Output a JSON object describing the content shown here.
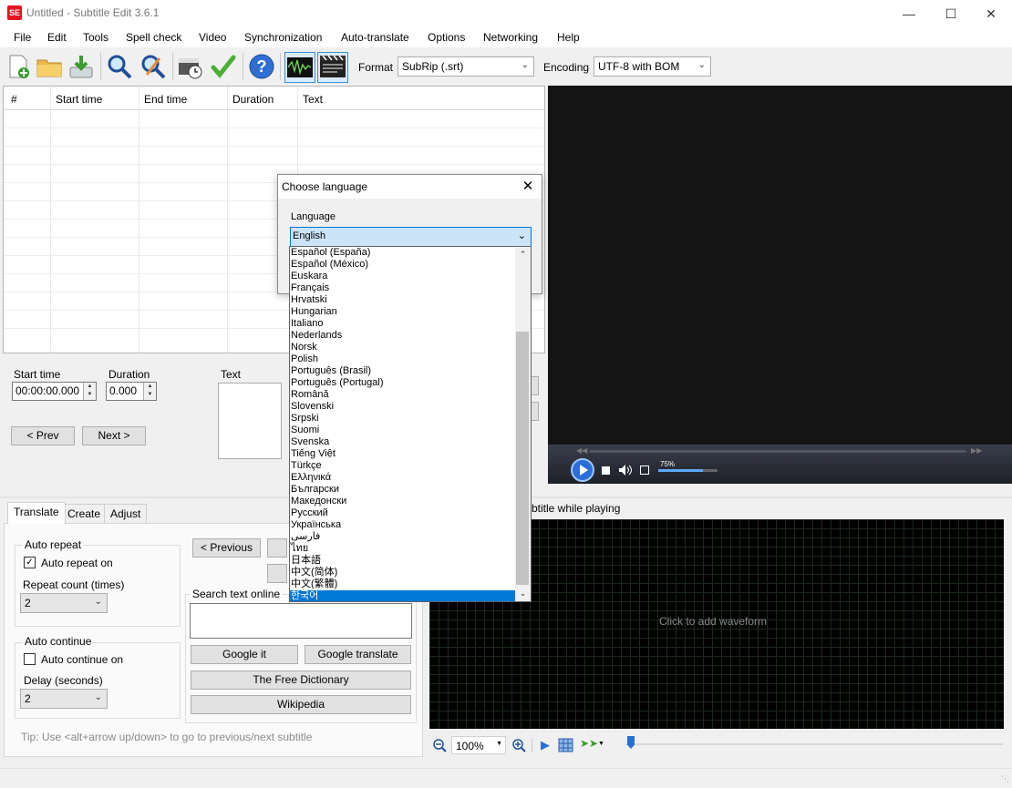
{
  "window": {
    "title": "Untitled - Subtitle Edit 3.6.1",
    "app_icon_text": "SE",
    "minimize": "—",
    "maximize": "☐",
    "close": "✕"
  },
  "menu": [
    "File",
    "Edit",
    "Tools",
    "Spell check",
    "Video",
    "Synchronization",
    "Auto-translate",
    "Options",
    "Networking",
    "Help"
  ],
  "toolbar": {
    "format_label": "Format",
    "format_value": "SubRip (.srt)",
    "encoding_label": "Encoding",
    "encoding_value": "UTF-8 with BOM",
    "icons": [
      "new-file-icon",
      "open-folder-icon",
      "download-icon",
      "find-icon",
      "replace-icon",
      "visual-sync-icon",
      "spell-check-icon",
      "help-icon",
      "waveform-toggle-icon",
      "video-toggle-icon"
    ]
  },
  "grid": {
    "columns": [
      "#",
      "Start time",
      "End time",
      "Duration",
      "Text"
    ]
  },
  "edit": {
    "start_time_label": "Start time",
    "start_time_value": "00:00:00.000",
    "duration_label": "Duration",
    "duration_value": "0.000",
    "text_label": "Text",
    "prev_label": "< Prev",
    "next_label": "Next >"
  },
  "video": {
    "volume_label": "75%"
  },
  "tabs": [
    "Translate",
    "Create",
    "Adjust"
  ],
  "translate": {
    "auto_repeat_title": "Auto repeat",
    "auto_repeat_on_label": "Auto repeat on",
    "auto_repeat_checked": true,
    "repeat_count_label": "Repeat count (times)",
    "repeat_count_value": "2",
    "auto_continue_title": "Auto continue",
    "auto_continue_on_label": "Auto continue on",
    "auto_continue_checked": false,
    "delay_label": "Delay (seconds)",
    "delay_value": "2",
    "previous_label": "< Previous",
    "search_online_label": "Search text online",
    "google_it": "Google it",
    "google_translate": "Google translate",
    "free_dictionary": "The Free Dictionary",
    "wikipedia": "Wikipedia",
    "tip": "Tip: Use <alt+arrow up/down> to go to previous/next subtitle"
  },
  "waveform": {
    "partial_label": "btitle while playing",
    "hint": "Click to add waveform",
    "zoom_value": "100%"
  },
  "dialog": {
    "title": "Choose language",
    "language_label": "Language",
    "selected": "English",
    "options": [
      "Español (España)",
      "Español (México)",
      "Euskara",
      "Français",
      "Hrvatski",
      "Hungarian",
      "Italiano",
      "Nederlands",
      "Norsk",
      "Polish",
      "Português (Brasil)",
      "Português (Portugal)",
      "Română",
      "Slovenski",
      "Srpski",
      "Suomi",
      "Svenska",
      "Tiếng Việt",
      "Türkçe",
      "Ελληνικά",
      "Български",
      "Македонски",
      "Русский",
      "Українська",
      "فارسی",
      "ไทย",
      "日本語",
      "中文(简体)",
      "中文(繁體)",
      "한국어"
    ],
    "highlighted": "한국어"
  }
}
